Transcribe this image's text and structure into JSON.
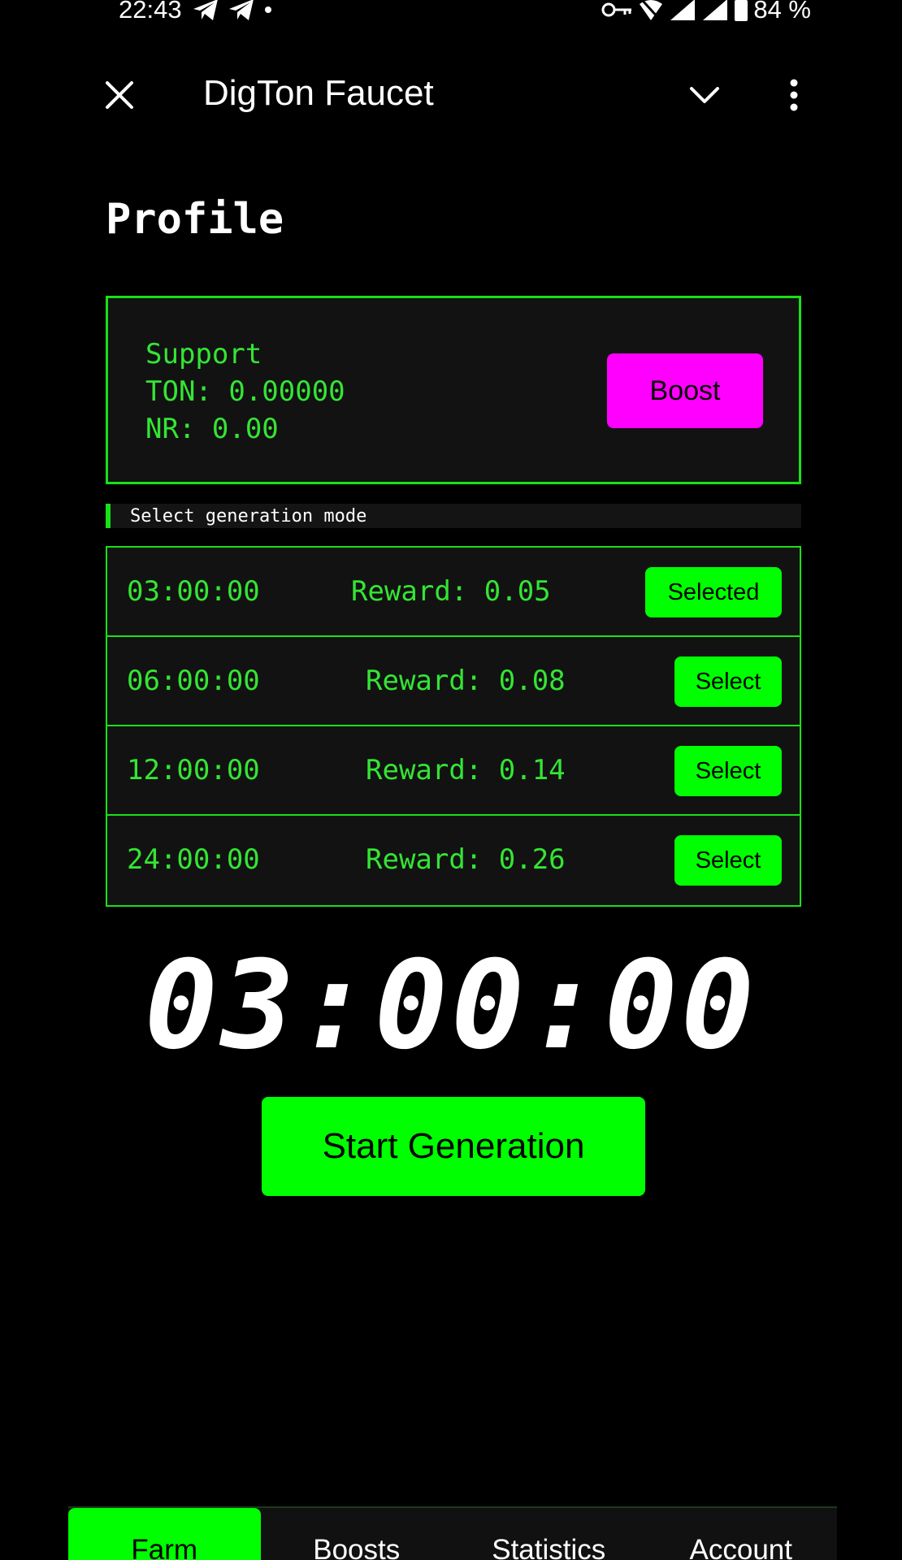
{
  "status_bar": {
    "time": "22:43",
    "battery": "84 %"
  },
  "header": {
    "title": "DigTon Faucet"
  },
  "page": {
    "title": "Profile"
  },
  "support_card": {
    "title": "Support",
    "ton_line": "TON: 0.00000",
    "nr_line": "NR: 0.00",
    "boost_label": "Boost"
  },
  "section": {
    "label": "Select generation mode"
  },
  "modes": [
    {
      "time": "03:00:00",
      "reward": "Reward: 0.05",
      "button": "Selected"
    },
    {
      "time": "06:00:00",
      "reward": "Reward: 0.08",
      "button": "Select"
    },
    {
      "time": "12:00:00",
      "reward": "Reward: 0.14",
      "button": "Select"
    },
    {
      "time": "24:00:00",
      "reward": "Reward: 0.26",
      "button": "Select"
    }
  ],
  "timer": {
    "value": "03:00:00"
  },
  "start_button": {
    "label": "Start Generation"
  },
  "nav": {
    "tabs": [
      {
        "label": "Farm",
        "active": true
      },
      {
        "label": "Boosts",
        "active": false
      },
      {
        "label": "Statistics",
        "active": false
      },
      {
        "label": "Account",
        "active": false
      }
    ]
  },
  "colors": {
    "accent": "#00ff00",
    "text_green": "#34e534",
    "boost": "#ff00ff",
    "background": "#000000"
  },
  "icons": {
    "close": "close-icon",
    "chevron": "chevron-down-icon",
    "more": "more-vertical-icon",
    "telegram": "telegram-icon",
    "key": "vpn-key-icon",
    "signal": "signal-icon",
    "battery": "battery-icon"
  }
}
